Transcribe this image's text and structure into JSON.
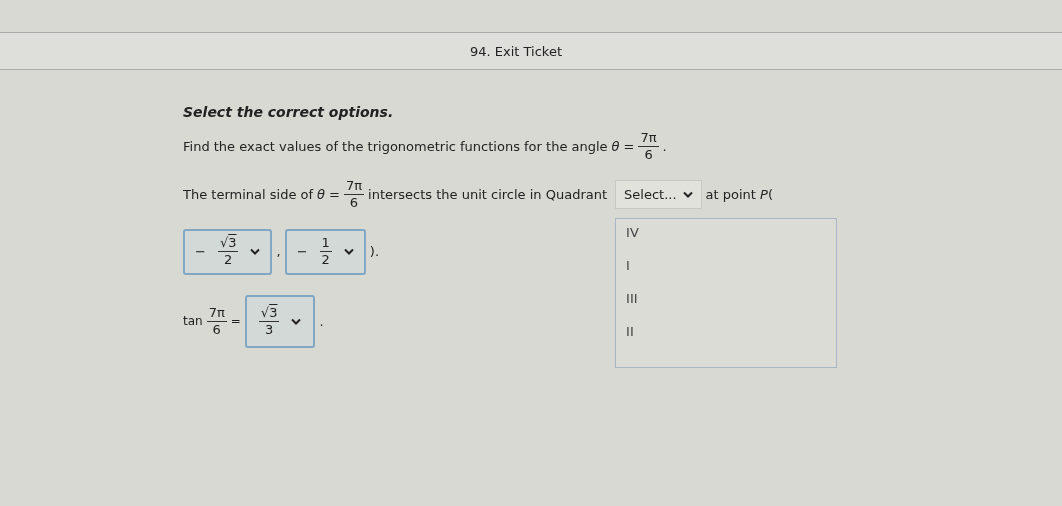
{
  "header": {
    "title": "94. Exit Ticket"
  },
  "instruction": "Select the correct options.",
  "question": {
    "text": "Find the exact values of the trigonometric functions for the angle",
    "variable": "θ",
    "equals": "=",
    "fraction": {
      "numerator": {
        "text": "7π"
      },
      "denominator": "6"
    },
    "end": "."
  },
  "quadrant_line": {
    "before": "The terminal side of",
    "variable": "θ",
    "equals": "=",
    "fraction": {
      "numerator": {
        "text": "7π"
      },
      "denominator": "6"
    },
    "middle": "intersects the unit circle in Quadrant",
    "dropdown": {
      "value": "Select...",
      "expanded": true,
      "options": [
        {
          "label": "IV",
          "selected": false
        },
        {
          "label": "I",
          "selected": false
        },
        {
          "label": "III",
          "selected": false
        },
        {
          "label": "II",
          "selected": false
        }
      ]
    },
    "after": "at point *P*("
  },
  "point_line": {
    "dropdowns": [
      {
        "sign": "−",
        "numerator": {
          "radical": "√",
          "radicand": "3"
        },
        "denominator": "2"
      },
      {
        "sign": "−",
        "numerator": {
          "text": "1"
        },
        "denominator": "2"
      }
    ],
    "separator": ",",
    "end": ")."
  },
  "tan_line": {
    "function": "tan",
    "fraction": {
      "numerator": {
        "text": "7π"
      },
      "denominator": "6"
    },
    "equals": "=",
    "dropdown": {
      "numerator": {
        "radical": "√",
        "radicand": "3"
      },
      "denominator": "3"
    },
    "end": "."
  }
}
